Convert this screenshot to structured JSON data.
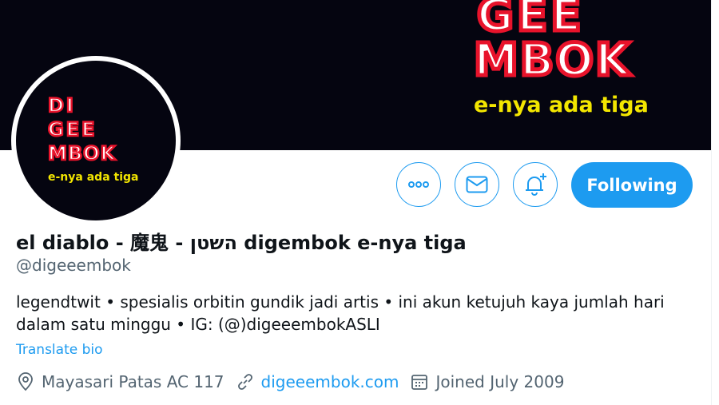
{
  "profile": {
    "display_name": "el diablo - 魔鬼 - השטן digembok e-nya tiga",
    "handle": "@digeeembok",
    "bio": "legendtwit • spesialis orbitin gundik jadi artis •  ini akun ketujuh kaya jumlah hari dalam satu minggu • IG: (@)digeeembokASLI",
    "translate_label": "Translate bio",
    "location": "Mayasari Patas AC 117",
    "website": "digeeembok.com",
    "joined": "Joined July 2009"
  },
  "actions": {
    "more_icon": "ellipsis-icon",
    "message_icon": "envelope-icon",
    "notify_icon": "bell-plus-icon",
    "follow_label": "Following"
  },
  "banner": {
    "logo_lines": [
      "GEE",
      "MBOK"
    ],
    "tagline": "e-nya ada tiga"
  },
  "avatar": {
    "logo_lines": [
      "DI",
      "GEE",
      "MBOK"
    ],
    "tagline": "e-nya ada tiga"
  },
  "colors": {
    "accent": "#1d9bf0",
    "banner_bg": "#050510",
    "logo_red": "#e8132b",
    "logo_yellow": "#f3e600",
    "text_secondary": "#536471"
  }
}
